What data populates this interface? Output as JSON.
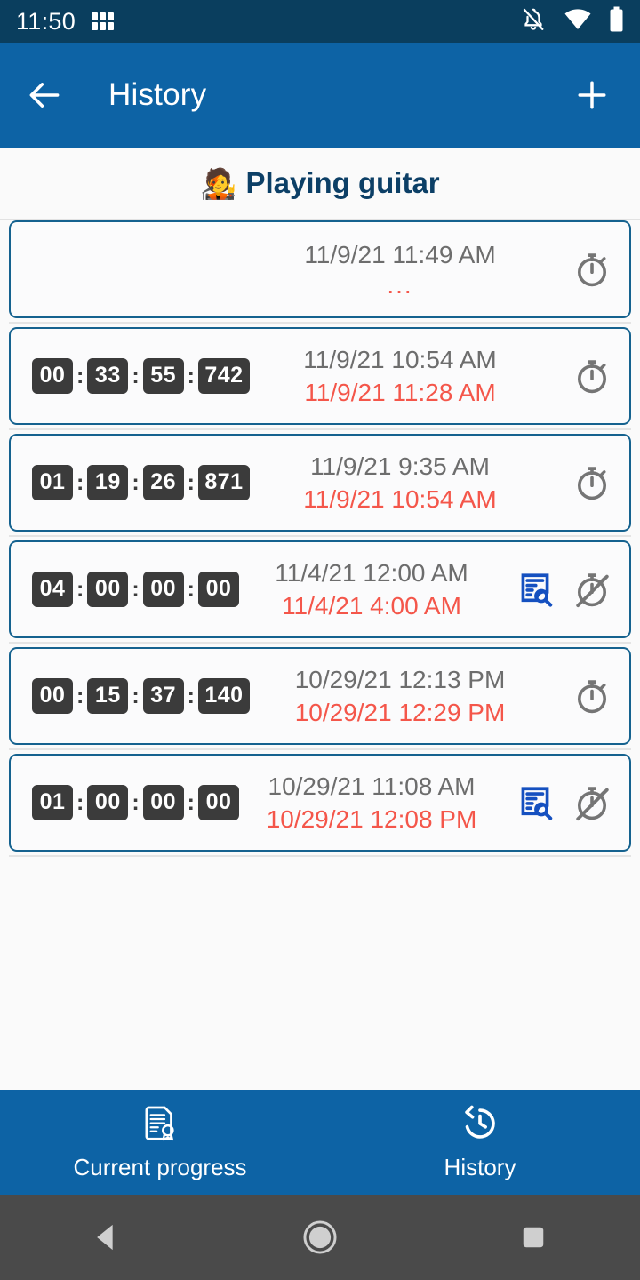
{
  "status_bar": {
    "time": "11:50",
    "icons": [
      "grid-apps-icon",
      "notifications-off-icon",
      "wifi-icon",
      "battery-full-icon"
    ]
  },
  "app_bar": {
    "title": "History",
    "back_icon": "arrow-back-icon",
    "add_icon": "plus-icon"
  },
  "activity": {
    "emoji": "🧑‍🎤",
    "name": "Playing guitar"
  },
  "colors": {
    "app_bar_blue": "#0d63a5",
    "status_bar_blue": "#0a3e5e",
    "card_border": "#15628f",
    "chip_bg": "#3b3b3b",
    "end_time_red": "#f4564a",
    "start_time_gray": "#6d6d6d",
    "title_navy": "#0c3f66",
    "doc_search_blue": "#1550c0",
    "timer_gray": "#757575"
  },
  "history": {
    "entries": [
      {
        "duration": null,
        "duration_parts": [],
        "start": "11/9/21 11:49 AM",
        "end": "...",
        "running": true,
        "has_note_icon": false,
        "timer_icon": "stopwatch-icon"
      },
      {
        "duration": "00:33:55:742",
        "duration_parts": [
          "00",
          "33",
          "55",
          "742"
        ],
        "start": "11/9/21 10:54 AM",
        "end": "11/9/21 11:28 AM",
        "running": false,
        "has_note_icon": false,
        "timer_icon": "stopwatch-icon"
      },
      {
        "duration": "01:19:26:871",
        "duration_parts": [
          "01",
          "19",
          "26",
          "871"
        ],
        "start": "11/9/21 9:35 AM",
        "end": "11/9/21 10:54 AM",
        "running": false,
        "has_note_icon": false,
        "timer_icon": "stopwatch-icon"
      },
      {
        "duration": "04:00:00:00",
        "duration_parts": [
          "04",
          "00",
          "00",
          "00"
        ],
        "start": "11/4/21 12:00 AM",
        "end": "11/4/21 4:00 AM",
        "running": false,
        "has_note_icon": true,
        "note_icon": "document-search-icon",
        "timer_icon": "stopwatch-off-icon"
      },
      {
        "duration": "00:15:37:140",
        "duration_parts": [
          "00",
          "15",
          "37",
          "140"
        ],
        "start": "10/29/21 12:13 PM",
        "end": "10/29/21 12:29 PM",
        "running": false,
        "has_note_icon": false,
        "timer_icon": "stopwatch-icon"
      },
      {
        "duration": "01:00:00:00",
        "duration_parts": [
          "01",
          "00",
          "00",
          "00"
        ],
        "start": "10/29/21 11:08 AM",
        "end": "10/29/21 12:08 PM",
        "running": false,
        "has_note_icon": true,
        "note_icon": "document-search-icon",
        "timer_icon": "stopwatch-off-icon"
      }
    ]
  },
  "bottom_nav": {
    "tabs": [
      {
        "label": "Current progress",
        "icon": "document-certificate-icon",
        "selected": false
      },
      {
        "label": "History",
        "icon": "history-clock-icon",
        "selected": true
      }
    ]
  },
  "android_nav": {
    "back": "triangle-back-icon",
    "home": "circle-home-icon",
    "recents": "square-recents-icon"
  }
}
